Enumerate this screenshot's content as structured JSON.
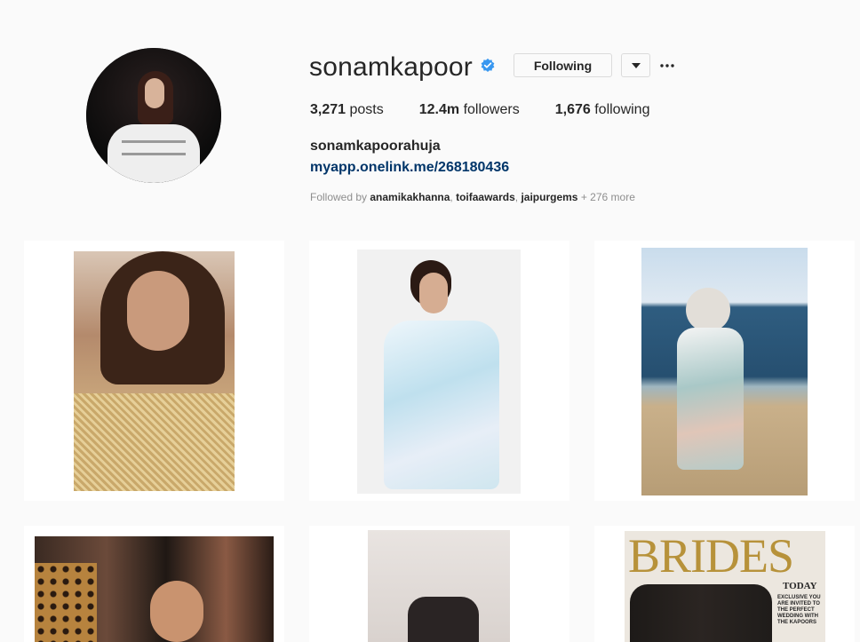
{
  "profile": {
    "username": "sonamkapoor",
    "follow_button_label": "Following",
    "stats": {
      "posts_count": "3,271",
      "posts_label": "posts",
      "followers_count": "12.4m",
      "followers_label": "followers",
      "following_count": "1,676",
      "following_label": "following"
    },
    "full_name": "sonamkapoorahuja",
    "link": "myapp.onelink.me/268180436",
    "followed_by": {
      "prefix": "Followed by ",
      "accounts": [
        "anamikakhanna",
        "toifaawards",
        "jaipurgems"
      ],
      "more": "+ 276 more"
    }
  },
  "icons": {
    "verified": "verified-badge-icon",
    "dropdown": "caret-down-icon",
    "more": "more-options-icon",
    "video": "video-camera-icon"
  },
  "colors": {
    "verified_blue": "#3897f0",
    "link_blue": "#003569",
    "muted_text": "#8e8e8e",
    "border": "#dbdbdb"
  },
  "posts": [
    {
      "has_video_icon": false
    },
    {
      "has_video_icon": false
    },
    {
      "has_video_icon": false
    },
    {
      "has_video_icon": false
    },
    {
      "has_video_icon": true
    },
    {
      "has_video_icon": false,
      "overlay_text": "BRIDES",
      "overlay_text2": "TODAY",
      "overlay_text3": "EXCLUSIVE YOU ARE INVITED TO THE PERFECT WEDDING WITH THE KAPOORS"
    }
  ]
}
